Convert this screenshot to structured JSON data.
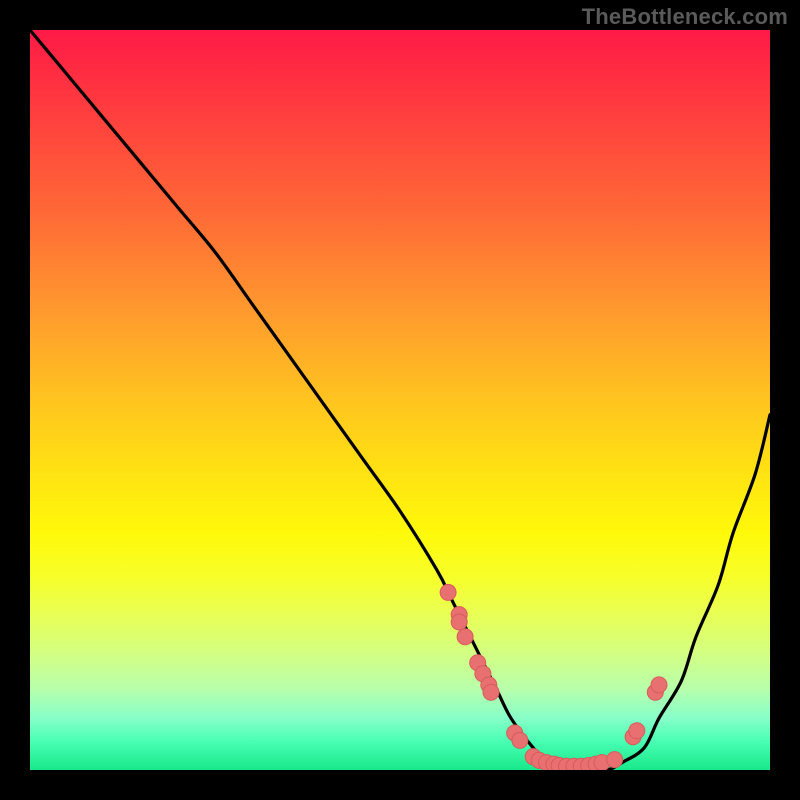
{
  "attribution": "TheBottleneck.com",
  "colors": {
    "black": "#000000",
    "dot_fill": "#e87070",
    "dot_stroke": "#d85b5b",
    "curve_stroke": "#000000",
    "gradient_top": "#ff1a46",
    "gradient_bottom": "#17e98a"
  },
  "chart_data": {
    "type": "line",
    "title": "",
    "xlabel": "",
    "ylabel": "",
    "xlim": [
      0,
      100
    ],
    "ylim": [
      0,
      100
    ],
    "series": [
      {
        "name": "bottleneck-curve",
        "x": [
          0,
          5,
          10,
          15,
          20,
          25,
          30,
          35,
          40,
          45,
          50,
          55,
          57,
          60,
          63,
          65,
          68,
          70,
          73,
          75,
          78,
          80,
          83,
          85,
          88,
          90,
          93,
          95,
          98,
          100
        ],
        "y": [
          100,
          94,
          88,
          82,
          76,
          70,
          63,
          56,
          49,
          42,
          35,
          27,
          23,
          17,
          11,
          7,
          3,
          1,
          0,
          0,
          0,
          1,
          3,
          7,
          12,
          18,
          25,
          32,
          40,
          48
        ]
      }
    ],
    "points": [
      {
        "x": 56.5,
        "y": 24
      },
      {
        "x": 58.0,
        "y": 21
      },
      {
        "x": 58.0,
        "y": 20
      },
      {
        "x": 58.8,
        "y": 18
      },
      {
        "x": 60.5,
        "y": 14.5
      },
      {
        "x": 61.2,
        "y": 13
      },
      {
        "x": 62.0,
        "y": 11.5
      },
      {
        "x": 62.3,
        "y": 10.5
      },
      {
        "x": 65.5,
        "y": 5
      },
      {
        "x": 66.2,
        "y": 4
      },
      {
        "x": 68.0,
        "y": 1.8
      },
      {
        "x": 68.8,
        "y": 1.3
      },
      {
        "x": 69.8,
        "y": 1.0
      },
      {
        "x": 70.8,
        "y": 0.8
      },
      {
        "x": 71.5,
        "y": 0.6
      },
      {
        "x": 72.5,
        "y": 0.5
      },
      {
        "x": 73.5,
        "y": 0.5
      },
      {
        "x": 74.5,
        "y": 0.5
      },
      {
        "x": 75.5,
        "y": 0.6
      },
      {
        "x": 76.5,
        "y": 0.8
      },
      {
        "x": 77.3,
        "y": 1.0
      },
      {
        "x": 79.0,
        "y": 1.4
      },
      {
        "x": 81.5,
        "y": 4.5
      },
      {
        "x": 82.0,
        "y": 5.3
      },
      {
        "x": 84.5,
        "y": 10.5
      },
      {
        "x": 85.0,
        "y": 11.5
      }
    ],
    "dot_radius": 8
  }
}
